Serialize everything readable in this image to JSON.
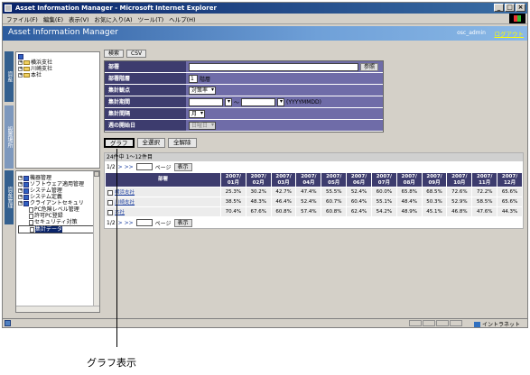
{
  "window": {
    "title": "Asset Information Manager - Microsoft Internet Explorer",
    "min": "_",
    "max": "□",
    "close": "×"
  },
  "menu": [
    "ファイル(F)",
    "編集(E)",
    "表示(V)",
    "お気に入り(A)",
    "ツール(T)",
    "ヘルプ(H)"
  ],
  "header": {
    "title": "Asset Information Manager",
    "user": "osc_admin",
    "logout": "ログアウト"
  },
  "left_tabs": {
    "top": "資産",
    "middle": "設置場所",
    "bottom": "資産管理"
  },
  "tree_top": [
    {
      "label": "横浜支社",
      "icon": "folder"
    },
    {
      "label": "川崎支社",
      "icon": "folder"
    },
    {
      "label": "本社",
      "icon": "folder"
    }
  ],
  "tree_bottom": [
    {
      "label": "機器管理",
      "icon": "book",
      "indent": 0
    },
    {
      "label": "ソフトウェア適用管理",
      "icon": "book",
      "indent": 0
    },
    {
      "label": "システム管理",
      "icon": "book",
      "indent": 0
    },
    {
      "label": "システム定義",
      "icon": "book",
      "indent": 0
    },
    {
      "label": "クライアントセキュリ",
      "icon": "book",
      "indent": 0
    },
    {
      "label": "PC危険レベル管理",
      "icon": "page",
      "indent": 1
    },
    {
      "label": "許可PC登録",
      "icon": "page",
      "indent": 1
    },
    {
      "label": "セキュリティ対策",
      "icon": "page",
      "indent": 1
    },
    {
      "label": "集計データ",
      "icon": "page",
      "indent": 1,
      "selected": true
    }
  ],
  "tabs": [
    "検索",
    "CSV"
  ],
  "form": {
    "dept_label": "部署",
    "dept_button": "参照",
    "level_label": "部署階層",
    "level_value": "1",
    "level_unit": "階層",
    "unit_label": "集計観点",
    "unit_value": "対策率",
    "period_label": "集計期間",
    "period_sep": "～",
    "period_format": "(YYYYMMDD)",
    "interval_label": "集計間隔",
    "interval_value": "月",
    "weekstart_label": "週の開始日",
    "weekstart_value": "日曜日"
  },
  "actions": [
    "グラフ",
    "全選択",
    "全解除"
  ],
  "results": {
    "count": "24件中 1～12件目",
    "pager": {
      "page": "1/2",
      "nav": ">  >>",
      "page_unit": "ページ",
      "show": "表示"
    },
    "dept_header": "部署",
    "months": [
      [
        "2007/",
        "01月"
      ],
      [
        "2007/",
        "02月"
      ],
      [
        "2007/",
        "03月"
      ],
      [
        "2007/",
        "04月"
      ],
      [
        "2007/",
        "05月"
      ],
      [
        "2007/",
        "06月"
      ],
      [
        "2007/",
        "07月"
      ],
      [
        "2007/",
        "08月"
      ],
      [
        "2007/",
        "09月"
      ],
      [
        "2007/",
        "10月"
      ],
      [
        "2007/",
        "11月"
      ],
      [
        "2007/",
        "12月"
      ]
    ],
    "rows": [
      {
        "dept": "横浜支社",
        "values": [
          "25.3%",
          "30.2%",
          "42.7%",
          "47.4%",
          "55.5%",
          "52.4%",
          "60.0%",
          "65.8%",
          "68.5%",
          "72.6%",
          "72.2%",
          "65.6%"
        ]
      },
      {
        "dept": "川崎支社",
        "values": [
          "38.5%",
          "48.3%",
          "46.4%",
          "52.4%",
          "60.7%",
          "60.4%",
          "55.1%",
          "48.4%",
          "50.3%",
          "52.9%",
          "58.5%",
          "65.6%"
        ]
      },
      {
        "dept": "本社",
        "values": [
          "70.4%",
          "67.6%",
          "60.8%",
          "57.4%",
          "60.8%",
          "62.4%",
          "54.2%",
          "48.9%",
          "45.1%",
          "46.8%",
          "47.6%",
          "44.3%"
        ]
      }
    ]
  },
  "status": {
    "zone": "イントラネット"
  },
  "callout": "グラフ表示"
}
